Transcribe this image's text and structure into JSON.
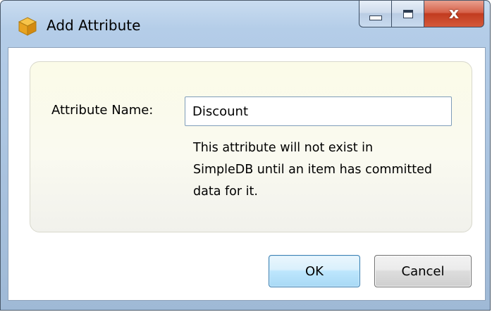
{
  "window": {
    "title": "Add Attribute",
    "icon": "cube-icon",
    "controls": {
      "minimize": "minimize-icon",
      "maximize": "maximize-icon",
      "close": "close-icon",
      "close_glyph": "x"
    }
  },
  "form": {
    "attribute_name_label": "Attribute Name:",
    "attribute_name_value": "Discount",
    "help_text": "This attribute will not exist in SimpleDB until an item has committed data for it."
  },
  "buttons": {
    "ok_label": "OK",
    "cancel_label": "Cancel"
  },
  "colors": {
    "close_button": "#c23b1f",
    "ok_button_border": "#3c7fb1",
    "panel_background": "#fbfbe8"
  }
}
